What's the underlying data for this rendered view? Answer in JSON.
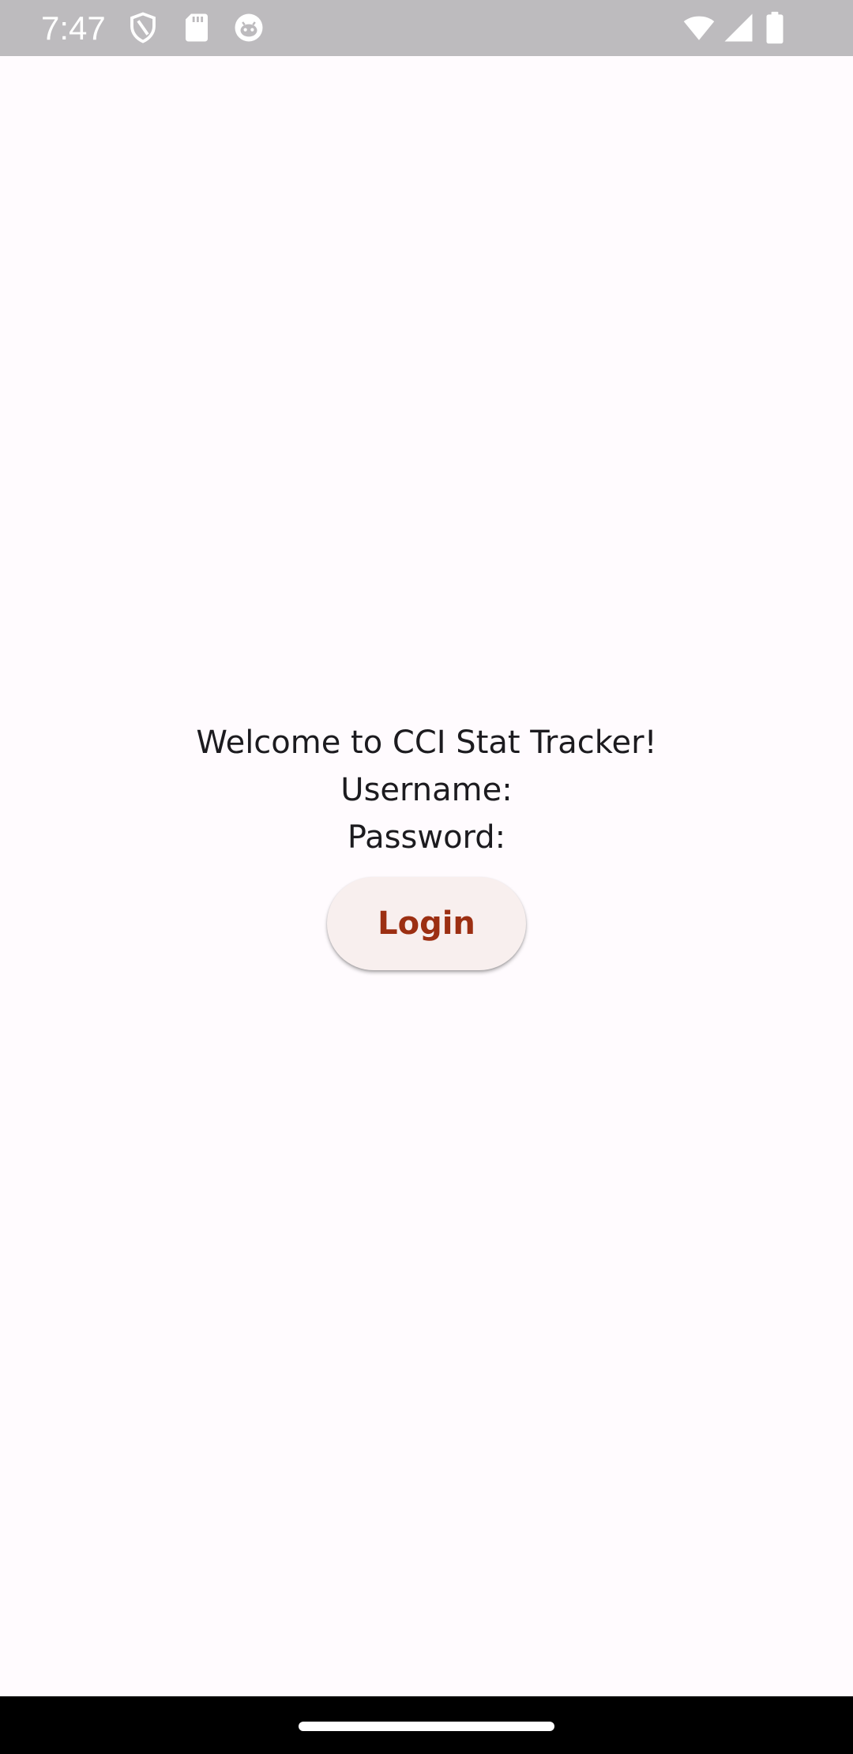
{
  "status_bar": {
    "time": "7:47",
    "left_icons": [
      "shield-icon",
      "sd-card-icon",
      "android-icon"
    ],
    "right_icons": [
      "wifi-icon",
      "signal-icon",
      "battery-icon"
    ],
    "background": "#bdbbbe"
  },
  "main": {
    "welcome_text": "Welcome to CCI Stat Tracker!",
    "username_label": "Username:",
    "password_label": "Password:",
    "login_label": "Login",
    "accent_color": "#9c2f12",
    "background": "#fffbfe"
  },
  "nav_bar": {
    "handle": "gesture-handle"
  }
}
